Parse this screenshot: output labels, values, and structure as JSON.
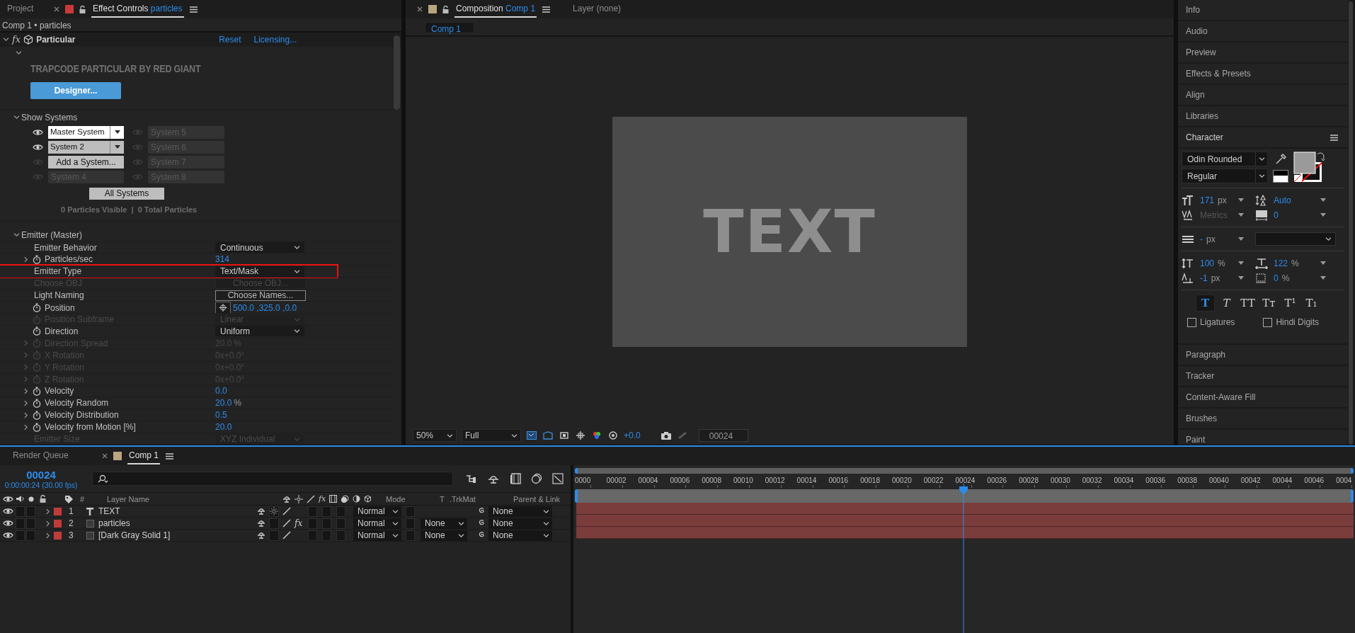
{
  "effect_controls": {
    "tabs": [
      {
        "label": "Project",
        "selected": false
      },
      {
        "label": "Effect Controls",
        "target": "particles",
        "selected": true
      }
    ],
    "breadcrumb": "Comp 1 • particles",
    "effect": {
      "fx_label": "fx",
      "name": "Particular",
      "expanded": true,
      "links": [
        "Reset",
        "Licensing..."
      ],
      "banner": "TRAPCODE PARTICULAR BY RED GIANT",
      "designer_button": "Designer...",
      "show_systems": {
        "label": "Show Systems",
        "expanded": true,
        "systems": [
          {
            "name": "Master System",
            "kind": "dropdown",
            "visible": true,
            "selected": true
          },
          {
            "name": "System 5",
            "kind": "empty",
            "visible": false,
            "selected": false
          },
          {
            "name": "System 2",
            "kind": "dropdown",
            "visible": true,
            "selected": false
          },
          {
            "name": "System 6",
            "kind": "empty",
            "visible": false,
            "selected": false
          },
          {
            "name": "Add a System...",
            "kind": "button",
            "visible": false,
            "selected": false
          },
          {
            "name": "System 7",
            "kind": "empty",
            "visible": false,
            "selected": false
          },
          {
            "name": "System 4",
            "kind": "empty",
            "visible": false,
            "selected": false
          },
          {
            "name": "System 8",
            "kind": "empty",
            "visible": false,
            "selected": false
          }
        ],
        "all_button": "All Systems",
        "stats": "0 Particles Visible  |  0 Total Particles"
      },
      "emitter": {
        "label": "Emitter (Master)",
        "expanded": true,
        "properties": [
          {
            "name": "Emitter Behavior",
            "kind": "dropdown",
            "value": "Continuous",
            "stopwatch": false,
            "disabled": false,
            "highlighted": false
          },
          {
            "name": "Particles/sec",
            "kind": "number",
            "value": "314",
            "expanded": false,
            "stopwatch": true,
            "disabled": false,
            "highlighted": false
          },
          {
            "name": "Emitter Type",
            "kind": "dropdown",
            "value": "Text/Mask",
            "stopwatch": false,
            "disabled": false,
            "highlighted": true
          },
          {
            "name": "Choose OBJ",
            "kind": "button",
            "value": "Choose OBJ...",
            "stopwatch": false,
            "disabled": true,
            "highlighted": false
          },
          {
            "name": "Light Naming",
            "kind": "button",
            "value": "Choose Names...",
            "stopwatch": false,
            "disabled": false,
            "highlighted": false
          },
          {
            "name": "Position",
            "kind": "point",
            "value": "500.0 ,325.0 ,0.0",
            "stopwatch": true,
            "disabled": false,
            "highlighted": false
          },
          {
            "name": "Position Subframe",
            "kind": "dropdown",
            "value": "Linear",
            "stopwatch": true,
            "disabled": true,
            "highlighted": false
          },
          {
            "name": "Direction",
            "kind": "dropdown",
            "value": "Uniform",
            "stopwatch": true,
            "disabled": false,
            "highlighted": false
          },
          {
            "name": "Direction Spread",
            "kind": "number",
            "value": "20.0",
            "unit": "%",
            "expanded": false,
            "stopwatch": true,
            "disabled": true,
            "highlighted": false
          },
          {
            "name": "X Rotation",
            "kind": "number",
            "value": "0x+0.0°",
            "expanded": false,
            "stopwatch": true,
            "disabled": true,
            "highlighted": false
          },
          {
            "name": "Y Rotation",
            "kind": "number",
            "value": "0x+0.0°",
            "expanded": false,
            "stopwatch": true,
            "disabled": true,
            "highlighted": false
          },
          {
            "name": "Z Rotation",
            "kind": "number",
            "value": "0x+0.0°",
            "expanded": false,
            "stopwatch": true,
            "disabled": true,
            "highlighted": false
          },
          {
            "name": "Velocity",
            "kind": "number",
            "value": "0.0",
            "expanded": false,
            "stopwatch": true,
            "disabled": false,
            "highlighted": false
          },
          {
            "name": "Velocity Random",
            "kind": "number",
            "value": "20.0",
            "unit": "%",
            "expanded": false,
            "stopwatch": true,
            "disabled": false,
            "highlighted": false
          },
          {
            "name": "Velocity Distribution",
            "kind": "number",
            "value": "0.5",
            "expanded": false,
            "stopwatch": true,
            "disabled": false,
            "highlighted": false
          },
          {
            "name": "Velocity from Motion [%]",
            "kind": "number",
            "value": "20.0",
            "expanded": false,
            "stopwatch": true,
            "disabled": false,
            "highlighted": false
          },
          {
            "name": "Emitter Size",
            "kind": "dropdown",
            "value": "XYZ Individual",
            "stopwatch": false,
            "disabled": true,
            "highlighted": false
          }
        ]
      }
    }
  },
  "composition": {
    "tabs": [
      {
        "label": "Composition",
        "target": "Comp 1",
        "selected": true
      },
      {
        "label": "Layer",
        "target": "(none)",
        "selected": false
      }
    ],
    "sub_tab": "Comp 1",
    "canvas_text": "TEXT",
    "toolbar": {
      "zoom": "50%",
      "resolution": "Full",
      "exposure": "+0.0",
      "timecode": "00024"
    }
  },
  "side_panels": {
    "panels": [
      {
        "title": "Info",
        "expanded": false
      },
      {
        "title": "Audio",
        "expanded": false
      },
      {
        "title": "Preview",
        "expanded": false
      },
      {
        "title": "Effects & Presets",
        "expanded": false
      },
      {
        "title": "Align",
        "expanded": false
      },
      {
        "title": "Libraries",
        "expanded": false
      },
      {
        "title": "Character",
        "expanded": true
      },
      {
        "title": "Paragraph",
        "expanded": false
      },
      {
        "title": "Tracker",
        "expanded": false
      },
      {
        "title": "Content-Aware Fill",
        "expanded": false
      },
      {
        "title": "Brushes",
        "expanded": false
      },
      {
        "title": "Paint",
        "expanded": false
      }
    ],
    "character": {
      "font": "Odin Rounded",
      "style": "Regular",
      "metrics": [
        {
          "value": "171",
          "unit": "px",
          "disabled": false
        },
        {
          "value": "Auto",
          "disabled": false
        },
        {
          "value": "Metrics",
          "disabled": true
        },
        {
          "value": "0",
          "disabled": false
        }
      ],
      "stroke": {
        "value": "-",
        "unit": "px"
      },
      "scales": [
        {
          "value": "100",
          "unit": "%",
          "disabled": false
        },
        {
          "value": "122",
          "unit": "%",
          "disabled": false
        },
        {
          "value": "-1",
          "unit": "px",
          "disabled": false
        },
        {
          "value": "0",
          "unit": "%",
          "disabled": false
        }
      ],
      "style_buttons": [
        {
          "label": "T",
          "kind": "bold",
          "selected": true
        },
        {
          "label": "T",
          "kind": "italic",
          "selected": false
        },
        {
          "label": "TT",
          "kind": "caps",
          "selected": false
        },
        {
          "label": "Tт",
          "kind": "smallcaps",
          "selected": false
        },
        {
          "label": "T¹",
          "kind": "super",
          "selected": false
        },
        {
          "label": "T₁",
          "kind": "sub",
          "selected": false
        }
      ],
      "options": [
        {
          "label": "Ligatures",
          "checked": false
        },
        {
          "label": "Hindi Digits",
          "checked": false
        }
      ]
    }
  },
  "timeline": {
    "tabs": [
      {
        "label": "Render Queue",
        "selected": false
      },
      {
        "label": "Comp 1",
        "selected": true
      }
    ],
    "timecode": "00024",
    "timecode_detail": "0:00:00:24 (30.00 fps)",
    "columns": {
      "number": "#",
      "name": "Layer Name",
      "switch_fx": "fx",
      "mode": "Mode",
      "track_matte_t": "T",
      "track_matte": ".TrkMat",
      "parent": "Parent & Link"
    },
    "layers": [
      {
        "number": "1",
        "kind": "text",
        "name": "TEXT",
        "color": "#c23b3b",
        "expanded": false,
        "collapse_switch": true,
        "mode": "Normal",
        "parent": "None"
      },
      {
        "number": "2",
        "kind": "solid",
        "name": "particles",
        "color": "#c23b3b",
        "expanded": false,
        "collapse_switch": false,
        "effects": {
          "label": "fx",
          "on": true
        },
        "mode": "Normal",
        "track_matte": "None",
        "parent": "None"
      },
      {
        "number": "3",
        "kind": "solid",
        "name": "[Dark Gray Solid 1]",
        "color": "#c23b3b",
        "expanded": false,
        "collapse_switch": false,
        "mode": "Normal",
        "track_matte": "None",
        "parent": "None"
      }
    ],
    "ruler_labels": [
      "0000",
      "00002",
      "00004",
      "00006",
      "00008",
      "00010",
      "00012",
      "00014",
      "00016",
      "00018",
      "00020",
      "00022",
      "00024",
      "00026",
      "00028",
      "00030",
      "00032",
      "00034",
      "00036",
      "00038",
      "00040",
      "00042",
      "00044",
      "00046",
      "0004"
    ],
    "playhead": {
      "level": 0.5
    }
  }
}
